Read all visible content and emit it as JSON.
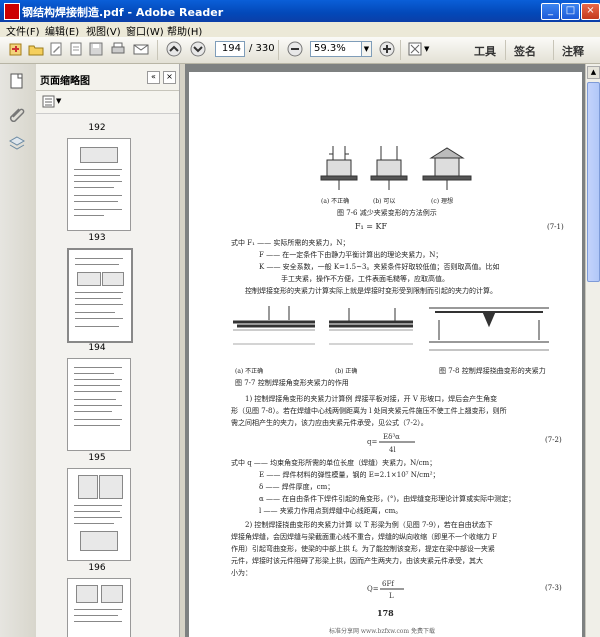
{
  "window": {
    "title": "钢结构焊接制造.pdf - Adobe Reader",
    "minimize": "_",
    "maximize": "□",
    "close": "×"
  },
  "menu": [
    "文件(F)",
    "编辑(E)",
    "视图(V)",
    "窗口(W)",
    "帮助(H)"
  ],
  "toolbar": {
    "page_value": "194",
    "page_total": "/ 330",
    "zoom_value": "59.3%",
    "tools_label": "工具",
    "sign_label": "签名",
    "comment_label": "注释"
  },
  "thumbnail_panel": {
    "title": "页面缩略图",
    "pages": [
      "192",
      "193",
      "194",
      "195",
      "196"
    ]
  },
  "page_content": {
    "fig76": {
      "caption": "图 7-6  减少夹紧变形的方法例示",
      "sub_a": "(a) 不正确",
      "sub_b": "(b) 可以",
      "sub_c": "(c) 理想"
    },
    "formula1": "F₁ = KF",
    "formula1_no": "(7-1)",
    "def1": "式中  F₁ —— 实际所需的夹紧力，N；",
    "def2": "F —— 在一定条件下由静力平衡计算出的理论夹紧力，N；",
    "def3": "K —— 安全系数，一般 K=1.5~3。夹紧条件好取较低值；否则取高值。比如",
    "def3b": "手工夹紧，操作不方便，工件表面毛糙等，应取高值。",
    "para1": "控制焊接变形的夹紧力计算实际上就是焊接时变形受到限制而引起的夹力的计算。",
    "fig77": {
      "caption": "图 7-7  控制焊接角变形夹紧力的作用",
      "sub_a": "(a) 不正确",
      "sub_b": "(b) 正确"
    },
    "fig78": {
      "caption": "图 7-8  控制焊接挠曲变形的夹紧力"
    },
    "para2_l1": "1) 控制焊接角变形的夹紧力计算例  焊接平板对接，开 V 形坡口，焊后会产生角变",
    "para2_l2": "形（见图 7-8）。若在焊缝中心线两侧距离为 l 处同夹紧元件施压不使工件上翘变形，则所",
    "para2_l3": "需之间相产生的夹力，该力应由夹紧元件承受，见公式（7-2）。",
    "formula2_no": "(7-2)",
    "def4": "式中  q —— 均束角变形所需的单位长度（焊缝）夹紧力，N/cm；",
    "def5": "E —— 焊件材料的弹性模量，钢的 E=2.1×10⁷ N/cm²；",
    "def6": "δ —— 焊件厚度，cm；",
    "def7": "α —— 在自由条件下焊件引起的角变形，(°)，由焊缝变形理论计算或实际中测定；",
    "def8": "l —— 夹紧力作用点到焊缝中心线距离，cm。",
    "para3_l1": "2) 控制焊接挠曲变形的夹紧力计算  以 T 形梁为例（见图 7-9），若在自由状态下",
    "para3_l2": "焊接角焊缝，会因焊缝与梁截面重心线不重合，焊缝的纵向收缩（即里不一个收缩力 F",
    "para3_l3": "作用）引起弯曲变形，使梁的中部上拱 f。为了能控制该变形，提定在梁中部设一夹紧",
    "para3_l4": "元件，焊接时该元件阻碍了形梁上拱，因而产生两夹力，由该夹紧元件承受，其大",
    "para3_l5": "小为：",
    "formula3_no": "(7-3)",
    "page_number": "178",
    "footer": "标准分享网 www.bzfxw.com 免费下载"
  },
  "colors": {
    "titlebar": "#0348b8",
    "viewer_bg": "#7e8181",
    "panel_bg": "#f5f4ef"
  }
}
